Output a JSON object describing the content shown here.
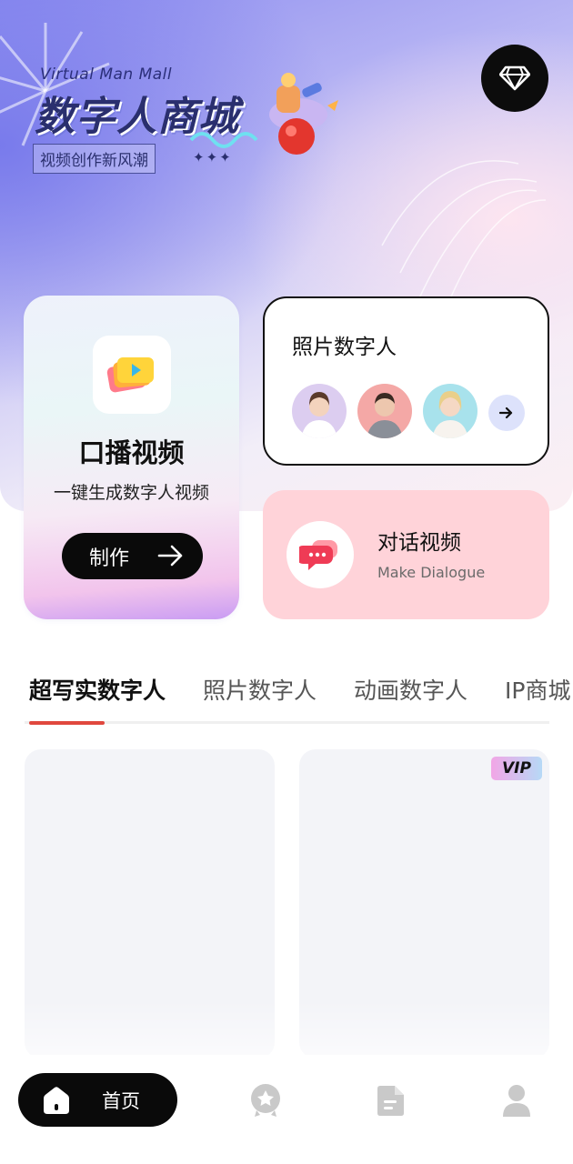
{
  "header": {
    "logo_en": "Virtual Man Mall",
    "logo_cn": "数字人商城",
    "logo_sub": "视频创作新风潮",
    "logo_stars": "✦✦✦"
  },
  "cards": {
    "oral": {
      "title": "口播视频",
      "subtitle": "一键生成数字人视频",
      "button": "制作"
    },
    "photo": {
      "title": "照片数字人"
    },
    "dialog": {
      "title": "对话视频",
      "subtitle": "Make Dialogue"
    }
  },
  "tabs": [
    {
      "label": "超写实数字人",
      "active": true
    },
    {
      "label": "照片数字人",
      "active": false
    },
    {
      "label": "动画数字人",
      "active": false
    },
    {
      "label": "IP商城",
      "active": false
    }
  ],
  "items": [
    {
      "badge": ""
    },
    {
      "badge": "VIP"
    }
  ],
  "nav": {
    "home_label": "首页"
  },
  "colors": {
    "accent": "#e0483e",
    "dialog_card": "#ffd3d9",
    "nav_active": "#0a0a0a"
  }
}
